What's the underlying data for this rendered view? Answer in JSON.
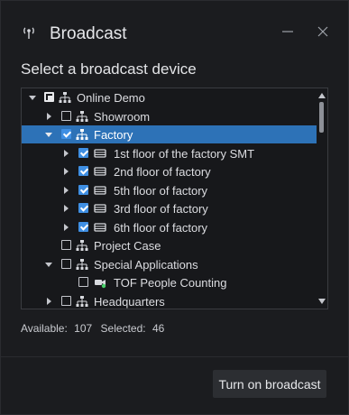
{
  "window": {
    "title": "Broadcast",
    "icons": {
      "broadcast": "broadcast-icon",
      "minimize": "minimize-icon",
      "close": "close-icon"
    }
  },
  "heading": "Select a broadcast device",
  "tree": {
    "items": [
      {
        "label": "Online Demo",
        "icon": "network-icon",
        "check": "partial",
        "expanded": true
      },
      {
        "label": "Showroom",
        "icon": "network-icon",
        "check": "unchecked",
        "expanded": false
      },
      {
        "label": "Factory",
        "icon": "network-icon",
        "check": "checked",
        "expanded": true,
        "selected": true
      },
      {
        "label": "1st floor of the factory SMT",
        "icon": "device-icon",
        "check": "checked",
        "expanded": false
      },
      {
        "label": "2nd floor of factory",
        "icon": "device-icon",
        "check": "checked",
        "expanded": false
      },
      {
        "label": "5th floor of factory",
        "icon": "device-icon",
        "check": "checked",
        "expanded": false
      },
      {
        "label": "3rd floor of factory",
        "icon": "device-icon",
        "check": "checked",
        "expanded": false
      },
      {
        "label": "6th floor of factory",
        "icon": "device-icon",
        "check": "checked",
        "expanded": false
      },
      {
        "label": "Project Case",
        "icon": "network-icon",
        "check": "unchecked"
      },
      {
        "label": "Special Applications",
        "icon": "network-icon",
        "check": "unchecked",
        "expanded": true
      },
      {
        "label": "TOF People Counting",
        "icon": "camera-online-icon",
        "check": "unchecked"
      },
      {
        "label": "Headquarters",
        "icon": "network-icon",
        "check": "unchecked",
        "expanded": false
      }
    ]
  },
  "status": {
    "available_label": "Available:",
    "available_value": "107",
    "selected_label": "Selected:",
    "selected_value": "46"
  },
  "actions": {
    "turn_on_label": "Turn on broadcast"
  },
  "colors": {
    "accent": "#2d72b7",
    "checkbox": "#3f8fe3",
    "background": "#1b1c1f",
    "online": "#49d16b"
  }
}
